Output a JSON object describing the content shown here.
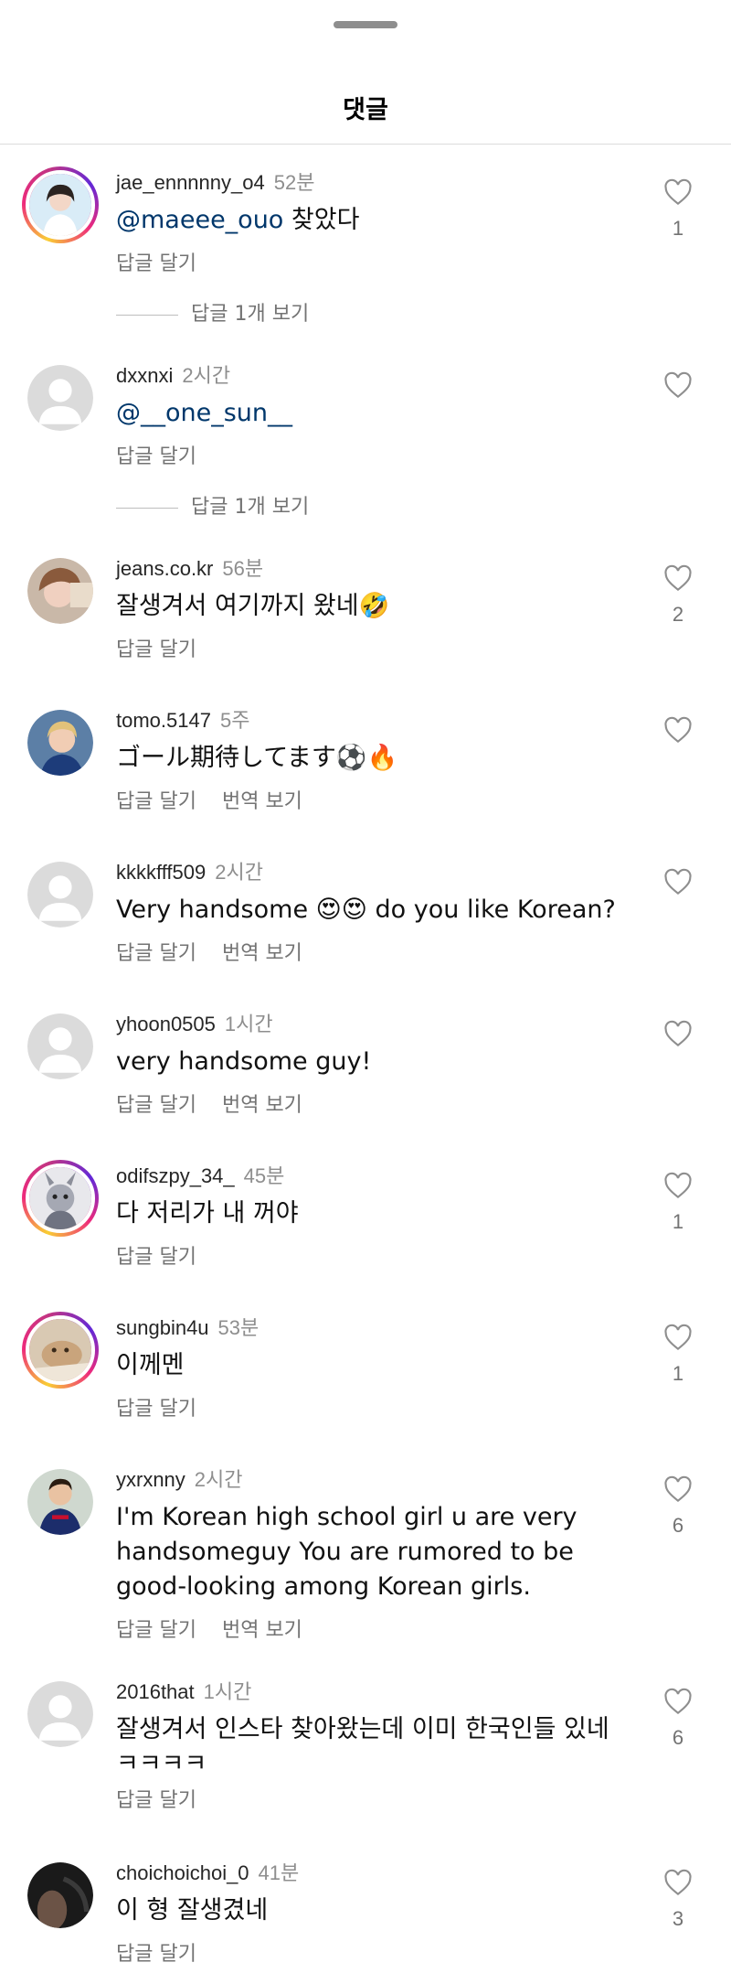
{
  "header": {
    "title": "댓글"
  },
  "comments": [
    {
      "username": "jae_ennnnny_o4",
      "time": "52분",
      "mention": "@maeee_ouo",
      "text": " 찾았다",
      "reply_label": "답글 달기",
      "view_replies": "답글 1개 보기",
      "likes": "1",
      "avatar_ring": true
    },
    {
      "username": "dxxnxi",
      "time": "2시간",
      "mention": "@__one_sun__",
      "text": "",
      "reply_label": "답글 달기",
      "view_replies": "답글 1개 보기",
      "likes": "",
      "avatar_ring": false
    },
    {
      "username": "jeans.co.kr",
      "time": "56분",
      "mention": "",
      "text": "잘생겨서 여기까지 왔네🤣",
      "reply_label": "답글 달기",
      "likes": "2",
      "avatar_ring": false
    },
    {
      "username": "tomo.5147",
      "time": "5주",
      "mention": "",
      "text": "ゴール期待してます⚽🔥",
      "reply_label": "답글 달기",
      "translate_label": "번역 보기",
      "likes": "",
      "avatar_ring": false
    },
    {
      "username": "kkkkfff509",
      "time": "2시간",
      "mention": "",
      "text": "Very handsome 😍😍 do you like Korean?",
      "reply_label": "답글 달기",
      "translate_label": "번역 보기",
      "likes": "",
      "avatar_ring": false
    },
    {
      "username": "yhoon0505",
      "time": "1시간",
      "mention": "",
      "text": "very handsome guy!",
      "reply_label": "답글 달기",
      "translate_label": "번역 보기",
      "likes": "",
      "avatar_ring": false
    },
    {
      "username": "odifszpy_34_",
      "time": "45분",
      "mention": "",
      "text": "다 저리가 내 꺼야",
      "reply_label": "답글 달기",
      "likes": "1",
      "avatar_ring": true
    },
    {
      "username": "sungbin4u",
      "time": "53분",
      "mention": "",
      "text": "이께멘",
      "reply_label": "답글 달기",
      "likes": "1",
      "avatar_ring": true
    },
    {
      "username": "yxrxnny",
      "time": "2시간",
      "mention": "",
      "text": "I'm Korean high school girl u are very handsomeguy You are rumored to be good-looking among Korean girls.",
      "reply_label": "답글 달기",
      "translate_label": "번역 보기",
      "likes": "6",
      "avatar_ring": false
    },
    {
      "username": "2016that",
      "time": "1시간",
      "mention": "",
      "text": "잘생겨서 인스타 찾아왔는데 이미 한국인들 있네 ㅋㅋㅋㅋ",
      "reply_label": "답글 달기",
      "likes": "6",
      "avatar_ring": false
    },
    {
      "username": "choichoichoi_0",
      "time": "41분",
      "mention": "",
      "text": "이 형 잘생겼네",
      "reply_label": "답글 달기",
      "likes": "3",
      "avatar_ring": false
    }
  ]
}
